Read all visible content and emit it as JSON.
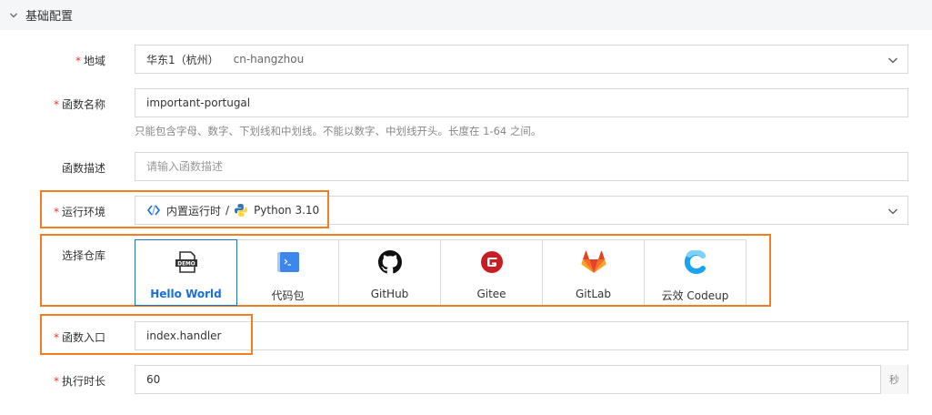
{
  "section": {
    "title": "基础配置"
  },
  "required_mark": "*",
  "region": {
    "label": "地域",
    "value": "华东1（杭州）",
    "sub": "cn-hangzhou"
  },
  "function_name": {
    "label": "函数名称",
    "value": "important-portugal",
    "help": "只能包含字母、数字、下划线和中划线。不能以数字、中划线开头。长度在 1-64 之间。"
  },
  "description": {
    "label": "函数描述",
    "placeholder": "请输入函数描述"
  },
  "runtime": {
    "label": "运行环境",
    "category": "内置运行时",
    "separator": "/",
    "version": "Python 3.10"
  },
  "repo": {
    "label": "选择仓库",
    "options": [
      {
        "name": "Hello World",
        "icon": "demo-file-icon",
        "selected": true
      },
      {
        "name": "代码包",
        "icon": "code-package-icon",
        "selected": false
      },
      {
        "name": "GitHub",
        "icon": "github-icon",
        "selected": false
      },
      {
        "name": "Gitee",
        "icon": "gitee-icon",
        "selected": false
      },
      {
        "name": "GitLab",
        "icon": "gitlab-icon",
        "selected": false
      },
      {
        "name": "云效 Codeup",
        "icon": "codeup-icon",
        "selected": false
      }
    ],
    "demo_badge": "DEMO"
  },
  "entry": {
    "label": "函数入口",
    "value": "index.handler"
  },
  "timeout": {
    "label": "执行时长",
    "value": "60",
    "unit": "秒"
  },
  "colors": {
    "highlight": "#f57c1f",
    "accent": "#1a6fd8",
    "required": "#e53935"
  }
}
